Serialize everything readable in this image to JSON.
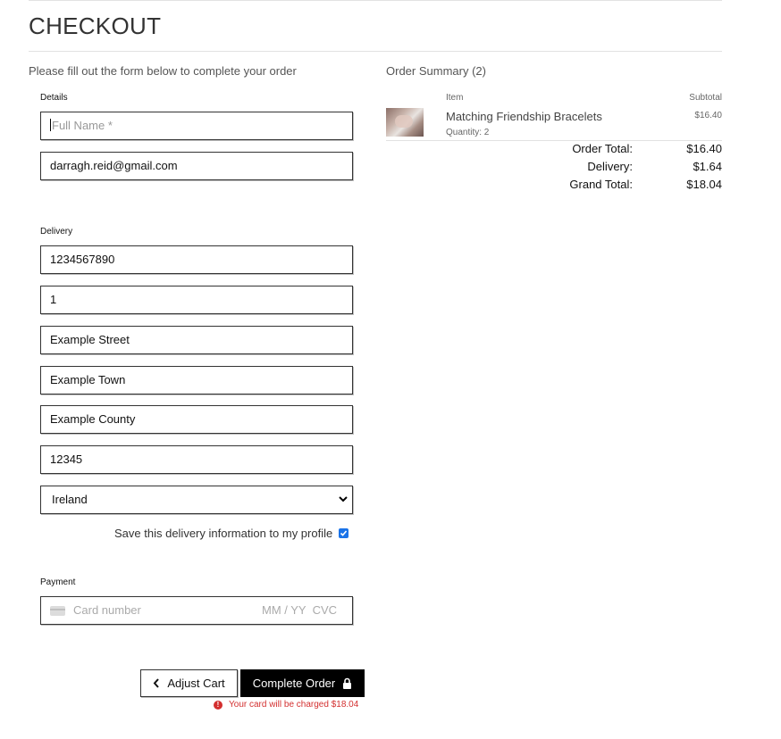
{
  "page": {
    "title": "CHECKOUT"
  },
  "form": {
    "intro": "Please fill out the form below to complete your order",
    "details": {
      "legend": "Details",
      "full_name_placeholder": "Full Name *",
      "email_value": "darragh.reid@gmail.com"
    },
    "delivery": {
      "legend": "Delivery",
      "phone_value": "1234567890",
      "address1_value": "1",
      "address2_value": "Example Street",
      "town_value": "Example Town",
      "county_value": "Example County",
      "postcode_value": "12345",
      "country_selected": "Ireland",
      "save_label": "Save this delivery information to my profile",
      "save_checked": true
    },
    "payment": {
      "legend": "Payment",
      "card_number_placeholder": "Card number",
      "card_expiry_placeholder": "MM / YY",
      "card_cvc_placeholder": "CVC"
    },
    "buttons": {
      "adjust_cart": "Adjust Cart",
      "complete_order": "Complete Order"
    },
    "charge_note": "Your card will be charged $18.04"
  },
  "summary": {
    "title": "Order Summary (2)",
    "col_item": "Item",
    "col_subtotal": "Subtotal",
    "items": [
      {
        "name": "Matching Friendship Bracelets",
        "quantity": "Quantity: 2",
        "subtotal": "$16.40"
      }
    ],
    "totals": {
      "order_total_label": "Order Total:",
      "order_total_value": "$16.40",
      "delivery_label": "Delivery:",
      "delivery_value": "$1.64",
      "grand_total_label": "Grand Total:",
      "grand_total_value": "$18.04"
    }
  },
  "colors": {
    "primary_button": "#000000",
    "error": "#d32f2f",
    "checkbox": "#1a73e8"
  },
  "icons": {
    "adjust_cart": "chevron-left-icon",
    "complete_order": "lock-icon",
    "charge_note": "alert-circle-icon",
    "card": "credit-card-icon"
  }
}
